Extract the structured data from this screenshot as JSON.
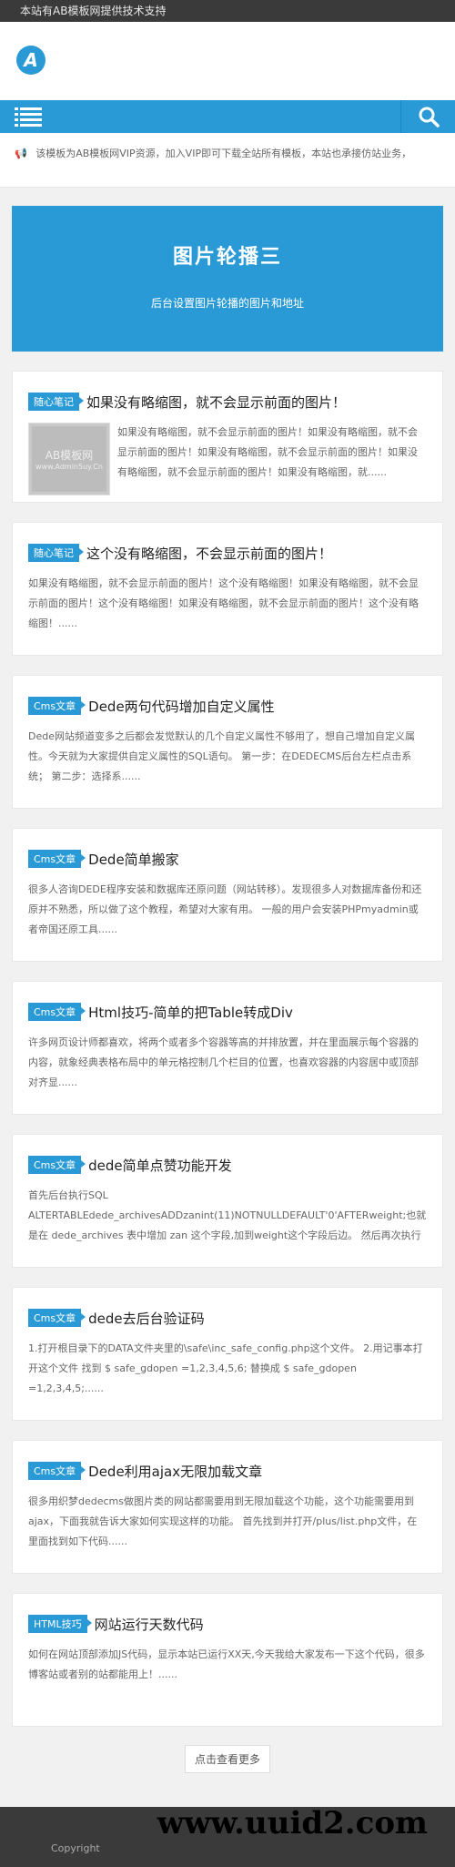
{
  "topbar": {
    "text": "本站有AB模板网提供技术支持"
  },
  "header": {
    "logo_letter": "A"
  },
  "notice": {
    "text": "该模板为AB模板网VIP资源，加入VIP即可下载全站所有模板，本站也承接仿站业务，"
  },
  "banner": {
    "title": "图片轮播三",
    "subtitle": "后台设置图片轮播的图片和地址"
  },
  "posts": [
    {
      "tag": "随心笔记",
      "title": "如果没有略缩图，就不会显示前面的图片！",
      "thumb": {
        "line1": "AB模板网",
        "line2": "www.Admin5uy.Cn"
      },
      "excerpt": "如果没有略缩图，就不会显示前面的图片！如果没有略缩图，就不会显示前面的图片！如果没有略缩图，就不会显示前面的图片！如果没有略缩图，就不会显示前面的图片！如果没有略缩图，就......"
    },
    {
      "tag": "随心笔记",
      "title": "这个没有略缩图，不会显示前面的图片！",
      "excerpt": "如果没有略缩图，就不会显示前面的图片！这个没有略缩图！如果没有略缩图，就不会显示前面的图片！这个没有略缩图！如果没有略缩图，就不会显示前面的图片！这个没有略缩图！......"
    },
    {
      "tag": "Cms文章",
      "title": "Dede两句代码增加自定义属性",
      "excerpt": "Dede网站频道变多之后都会发觉默认的几个自定义属性不够用了，想自己增加自定义属性。今天就为大家提供自定义属性的SQL语句。 第一步：在DEDECMS后台左栏点击系统； 第二步：选择系......"
    },
    {
      "tag": "Cms文章",
      "title": "Dede简单搬家",
      "excerpt": "很多人咨询DEDE程序安装和数据库还原问题（网站转移）。发现很多人对数据库备份和还原并不熟悉，所以做了这个教程，希望对大家有用。 一般的用户会安装PHPmyadmin或者帝国还原工具......"
    },
    {
      "tag": "Cms文章",
      "title": "Html技巧-简单的把Table转成Div",
      "excerpt": "许多网页设计师都喜欢，将两个或者多个容器等高的并排放置，并在里面展示每个容器的内容，就象经典表格布局中的单元格控制几个栏目的位置，也喜欢容器的内容居中或顶部对齐显......"
    },
    {
      "tag": "Cms文章",
      "title": "dede简单点赞功能开发",
      "excerpt": "首先后台执行SQL ALTERTABLEdede_archivesADDzanint(11)NOTNULLDEFAULT'0'AFTERweight;也就是在 dede_archives 表中增加 zan 这个字段,加到weight这个字段后边。 然后再次执行 CREATETABLEIFNOTEXISTS`dede_zan`(`id`int(......"
    },
    {
      "tag": "Cms文章",
      "title": "dede去后台验证码",
      "excerpt": "1.打开根目录下的DATA文件夹里的\\safe\\inc_safe_config.php这个文件。 2.用记事本打开这个文件 找到 $ safe_gdopen =1,2,3,4,5,6; 替换成 $ safe_gdopen =1,2,3,4,5;......"
    },
    {
      "tag": "Cms文章",
      "title": "Dede利用ajax无限加载文章",
      "excerpt": "很多用织梦dedecms做图片类的网站都需要用到无限加载这个功能，这个功能需要用到ajax，下面我就告诉大家如何实现这样的功能。 首先找到并打开/plus/list.php文件，在里面找到如下代码......"
    },
    {
      "tag": "HTML技巧",
      "title": "网站运行天数代码",
      "excerpt": "如何在网站顶部添加JS代码，显示本站已运行XX天,今天我给大家发布一下这个代码，很多博客站或者别的站都能用上！......"
    }
  ],
  "more": {
    "label": "点击查看更多"
  },
  "footer": {
    "copy": "Copyright",
    "watermark": "www.uuid2.com"
  },
  "colors": {
    "accent": "#2a9ad6",
    "topbar": "#3a3a3a"
  }
}
